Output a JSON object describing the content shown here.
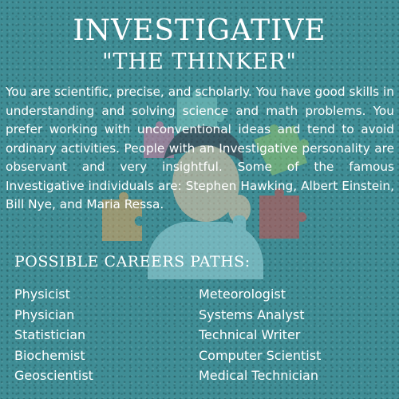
{
  "title": "INVESTIGATIVE",
  "subtitle": "\"THE THINKER\"",
  "description": "You are scientific, precise, and scholarly. You have good skills in understanding and solving science and math problems. You prefer working with unconventional ideas and tend to avoid ordinary activities. People with an Investigative personality are observant and very insightful. Some of the famous Investigative individuals are: Stephen Hawking, Albert Einstein, Bill Nye, and Maria Ressa.",
  "careers": {
    "heading": "POSSIBLE CAREERS PATHS:",
    "left": [
      "Physicist",
      "Physician",
      "Statistician",
      "Biochemist",
      "Geoscientist"
    ],
    "right": [
      "Meteorologist",
      "Systems Analyst",
      "Technical Writer",
      "Computer Scientist",
      "Medical Technician"
    ]
  },
  "colors": {
    "background": "#3f8d95",
    "text": "#ffffff",
    "puzzle_teal": "#6fb9b6",
    "puzzle_green": "#8fbe6a",
    "puzzle_orange": "#e0a25a",
    "puzzle_red": "#c8504f",
    "puzzle_pink": "#d97ca0"
  }
}
